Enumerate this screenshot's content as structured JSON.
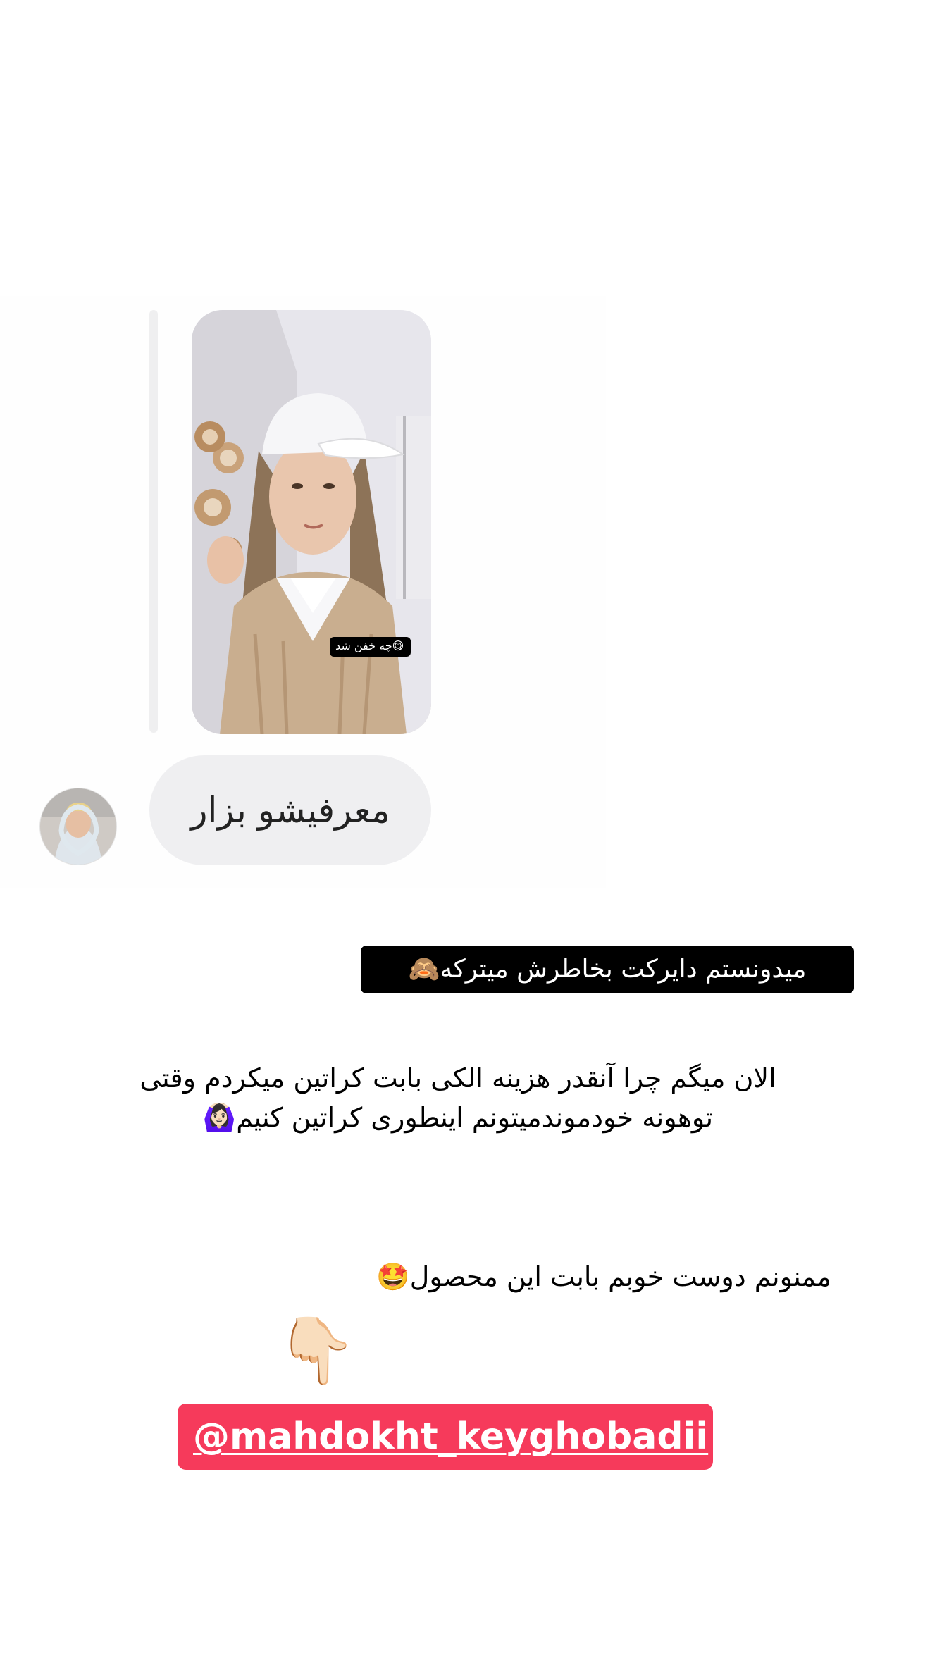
{
  "story": {
    "reply_message": {
      "text": "معرفیشو بزار",
      "video_caption": "چه خفن شد😋"
    },
    "captions": [
      {
        "text": "میدونستم دایرکت بخاطرش میترکه🙈"
      },
      {
        "text": "الان میگم چرا آنقدر هزینه الکی بابت کراتین میکردم وقتی توهونه خودموندمیتونم اینطوری کراتین کنیم🙆🏻‍♀️"
      },
      {
        "text": "ممنونم دوست خوبم بابت این محصول🤩"
      }
    ],
    "pointing_emoji": "👇🏻",
    "mention": {
      "label": "@mahdokht_keyghobadii",
      "color": "#f63a5b"
    }
  },
  "icons": {
    "avatar": "user-avatar-photo",
    "pointer": "pointing-down-hand-icon"
  }
}
